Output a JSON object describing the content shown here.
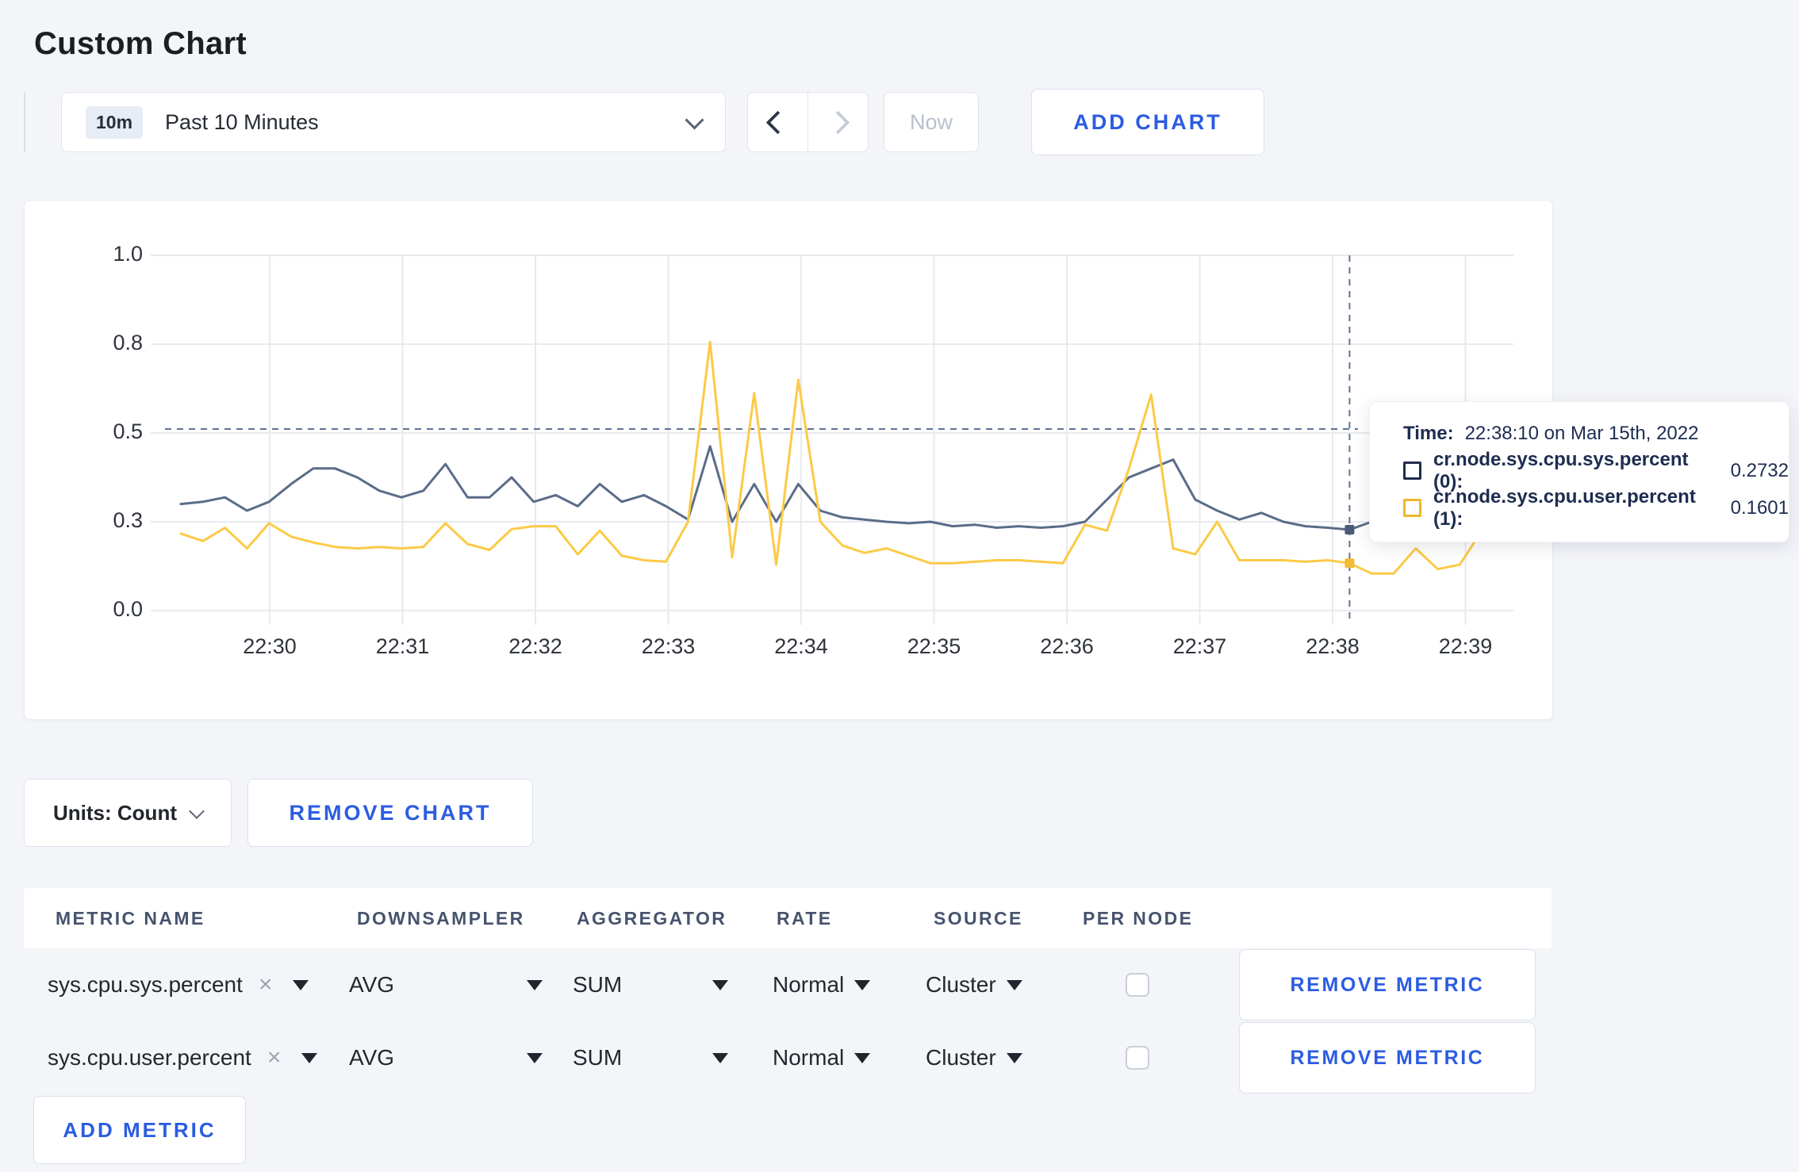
{
  "page_title": "Custom Chart",
  "toolbar": {
    "time_badge": "10m",
    "time_range_label": "Past 10 Minutes",
    "now_label": "Now",
    "add_chart_label": "ADD CHART"
  },
  "chart_actions": {
    "units_label": "Units: Count",
    "remove_chart_label": "REMOVE CHART"
  },
  "tooltip": {
    "time_label": "Time:",
    "time_value": "22:38:10 on Mar 15th, 2022",
    "series": [
      {
        "label": "cr.node.sys.cpu.sys.percent (0):",
        "value": "0.2732"
      },
      {
        "label": "cr.node.sys.cpu.user.percent (1):",
        "value": "0.1601"
      }
    ]
  },
  "chart_data": {
    "type": "line",
    "x_start": "22:29:20",
    "x_interval_seconds": 10,
    "x_ticks": [
      "22:30",
      "22:31",
      "22:32",
      "22:33",
      "22:34",
      "22:35",
      "22:36",
      "22:37",
      "22:38",
      "22:39"
    ],
    "y_ticks": [
      0.0,
      0.3,
      0.5,
      0.8,
      1.0
    ],
    "y_tick_labels": [
      "0.0",
      "0.3",
      "0.5",
      "0.8",
      "1.0"
    ],
    "ylim": [
      0,
      1
    ],
    "grid": true,
    "legend_position": "tooltip",
    "hover": {
      "index": 53,
      "time": "22:38:10 on Mar 15th, 2022",
      "values": [
        0.2732,
        0.1601
      ]
    },
    "series": [
      {
        "name": "cr.node.sys.cpu.sys.percent",
        "node": "0",
        "line_color": "#5b6c89",
        "swatch_color": "#1f2d4d",
        "values": [
          0.34,
          0.345,
          0.355,
          0.325,
          0.345,
          0.385,
          0.42,
          0.42,
          0.4,
          0.37,
          0.355,
          0.37,
          0.43,
          0.355,
          0.355,
          0.4,
          0.345,
          0.36,
          0.335,
          0.385,
          0.345,
          0.36,
          0.335,
          0.305,
          0.47,
          0.3,
          0.385,
          0.3,
          0.385,
          0.325,
          0.31,
          0.305,
          0.3,
          0.295,
          0.3,
          0.285,
          0.29,
          0.28,
          0.285,
          0.28,
          0.285,
          0.3,
          0.35,
          0.4,
          0.42,
          0.44,
          0.35,
          0.325,
          0.305,
          0.32,
          0.3,
          0.285,
          0.28,
          0.2732,
          0.3,
          0.295,
          0.31,
          0.3,
          0.295,
          0.3
        ]
      },
      {
        "name": "cr.node.sys.cpu.user.percent",
        "node": "1",
        "line_color": "#fcca46",
        "swatch_color": "#efb72a",
        "values": [
          0.26,
          0.235,
          0.28,
          0.21,
          0.295,
          0.25,
          0.23,
          0.215,
          0.21,
          0.215,
          0.21,
          0.215,
          0.295,
          0.225,
          0.205,
          0.275,
          0.285,
          0.285,
          0.19,
          0.27,
          0.185,
          0.17,
          0.165,
          0.3,
          0.805,
          0.18,
          0.635,
          0.155,
          0.68,
          0.3,
          0.22,
          0.195,
          0.21,
          0.185,
          0.16,
          0.16,
          0.165,
          0.17,
          0.17,
          0.165,
          0.16,
          0.29,
          0.27,
          0.42,
          0.63,
          0.21,
          0.19,
          0.3,
          0.17,
          0.17,
          0.17,
          0.165,
          0.17,
          0.1601,
          0.125,
          0.125,
          0.21,
          0.14,
          0.155,
          0.27
        ]
      }
    ]
  },
  "metrics_table": {
    "headers": [
      "METRIC NAME",
      "DOWNSAMPLER",
      "AGGREGATOR",
      "RATE",
      "SOURCE",
      "PER NODE"
    ],
    "rows": [
      {
        "metric_name": "sys.cpu.sys.percent",
        "downsampler": "AVG",
        "aggregator": "SUM",
        "rate": "Normal",
        "source": "Cluster",
        "per_node": false,
        "remove_label": "REMOVE METRIC"
      },
      {
        "metric_name": "sys.cpu.user.percent",
        "downsampler": "AVG",
        "aggregator": "SUM",
        "rate": "Normal",
        "source": "Cluster",
        "per_node": false,
        "remove_label": "REMOVE METRIC"
      }
    ],
    "add_metric_label": "ADD METRIC"
  },
  "icons": {
    "clear": "×"
  },
  "colors": {
    "accent_blue": "#2b5ce2",
    "page_bg": "#f4f5f9",
    "grid_line": "#e9eaef",
    "crosshair": "#5f7392",
    "disabled_text": "#b9c0cc"
  }
}
